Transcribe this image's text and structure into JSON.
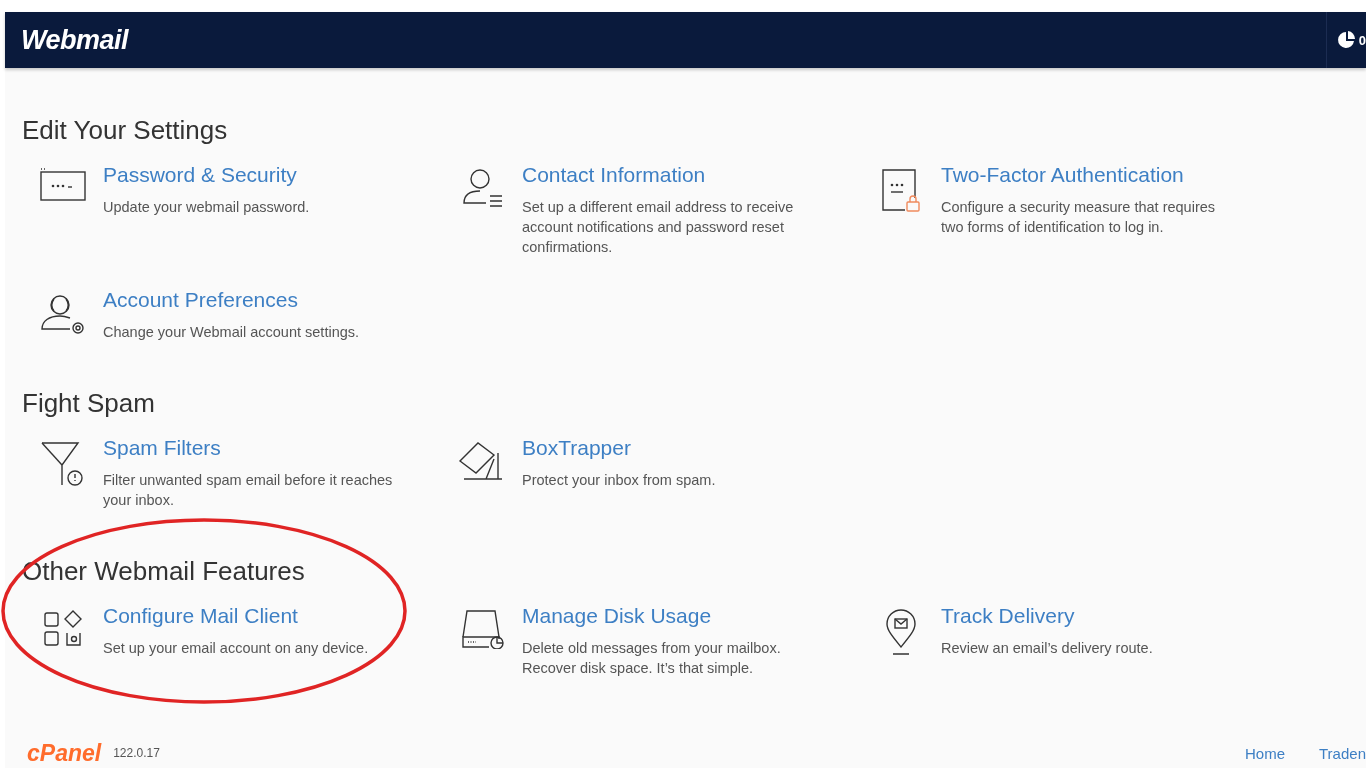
{
  "header": {
    "logo": "Webmail",
    "counter": "0"
  },
  "sections": [
    {
      "title": "Edit Your Settings",
      "items": [
        {
          "title": "Password & Security",
          "description": "Update your webmail password."
        },
        {
          "title": "Contact Information",
          "description": "Set up a different email address to receive account notifications and password reset confirmations."
        },
        {
          "title": "Two-Factor Authentication",
          "description": "Configure a security measure that requires two forms of identification to log in."
        },
        {
          "title": "Account Preferences",
          "description": "Change your Webmail account settings."
        }
      ]
    },
    {
      "title": "Fight Spam",
      "items": [
        {
          "title": "Spam Filters",
          "description": "Filter unwanted spam email before it reaches your inbox."
        },
        {
          "title": "BoxTrapper",
          "description": "Protect your inbox from spam."
        }
      ]
    },
    {
      "title": "Other Webmail Features",
      "items": [
        {
          "title": "Configure Mail Client",
          "description": "Set up your email account on any device."
        },
        {
          "title": "Manage Disk Usage",
          "description": "Delete old messages from your mailbox. Recover disk space. It’s that simple."
        },
        {
          "title": "Track Delivery",
          "description": "Review an email’s delivery route."
        }
      ]
    }
  ],
  "footer": {
    "logo": "cPanel",
    "version": "122.0.17",
    "links": [
      "Home",
      "Traden"
    ]
  }
}
